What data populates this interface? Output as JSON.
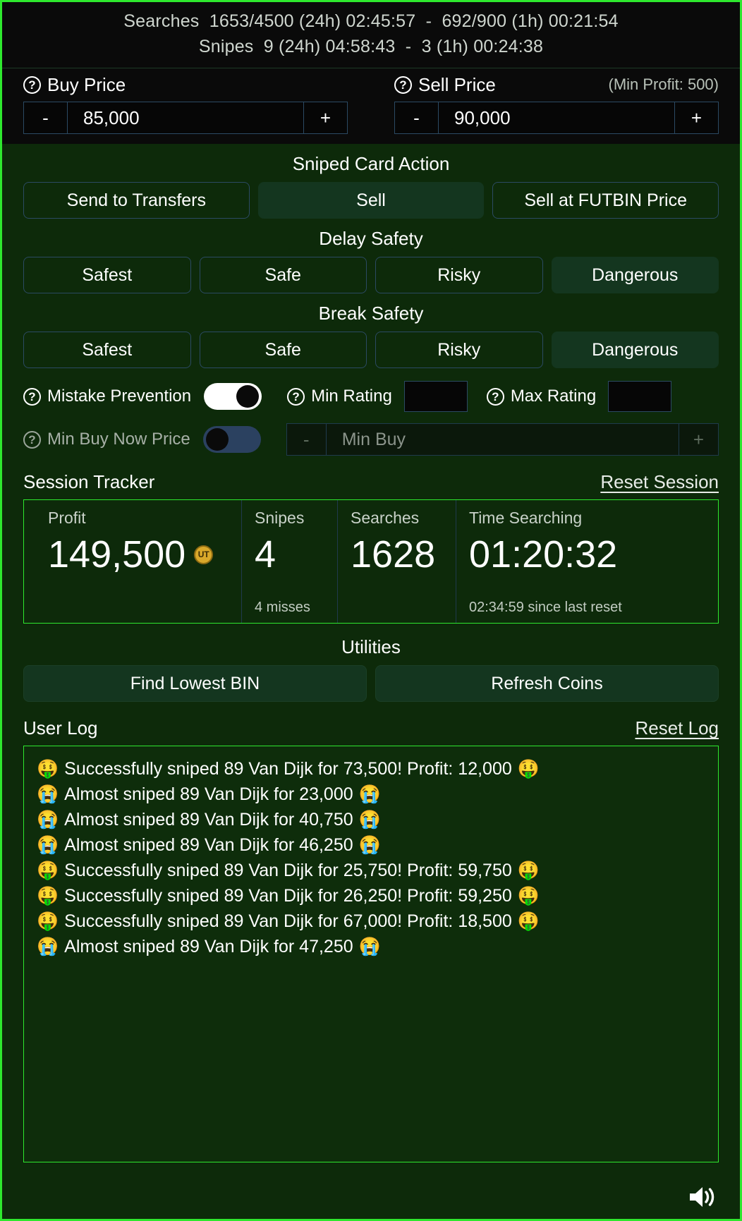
{
  "stats": {
    "line1": "Searches  1653/4500 (24h) 02:45:57  -  692/900 (1h) 00:21:54",
    "line2": "Snipes  9 (24h) 04:58:43  -  3 (1h) 00:24:38"
  },
  "prices": {
    "buy": {
      "label": "Buy Price",
      "value": "85,000",
      "minus": "-",
      "plus": "+"
    },
    "sell": {
      "label": "Sell Price",
      "value": "90,000",
      "minus": "-",
      "plus": "+",
      "min_profit": "(Min Profit: 500)"
    }
  },
  "sniped_card_action": {
    "title": "Sniped Card Action",
    "options": [
      {
        "label": "Send to Transfers",
        "active": false
      },
      {
        "label": "Sell",
        "active": true
      },
      {
        "label": "Sell at FUTBIN Price",
        "active": false
      }
    ]
  },
  "delay_safety": {
    "title": "Delay Safety",
    "options": [
      {
        "label": "Safest",
        "active": false
      },
      {
        "label": "Safe",
        "active": false
      },
      {
        "label": "Risky",
        "active": false
      },
      {
        "label": "Dangerous",
        "active": true
      }
    ]
  },
  "break_safety": {
    "title": "Break Safety",
    "options": [
      {
        "label": "Safest",
        "active": false
      },
      {
        "label": "Safe",
        "active": false
      },
      {
        "label": "Risky",
        "active": false
      },
      {
        "label": "Dangerous",
        "active": true
      }
    ]
  },
  "settings": {
    "mistake_prevention": {
      "label": "Mistake Prevention",
      "on": true
    },
    "min_rating": {
      "label": "Min Rating",
      "value": ""
    },
    "max_rating": {
      "label": "Max Rating",
      "value": ""
    },
    "min_buy_now_price": {
      "label": "Min Buy Now Price",
      "on": false,
      "placeholder": "Min Buy",
      "value": "",
      "minus": "-",
      "plus": "+"
    }
  },
  "session_tracker": {
    "title": "Session Tracker",
    "reset_label": "Reset Session",
    "profit": {
      "caption": "Profit",
      "value": "149,500",
      "coin_icon": "coin-icon",
      "coin_text": "UT"
    },
    "snipes": {
      "caption": "Snipes",
      "value": "4",
      "sub": "4 misses"
    },
    "searches": {
      "caption": "Searches",
      "value": "1628"
    },
    "time_searching": {
      "caption": "Time Searching",
      "value": "01:20:32",
      "sub": "02:34:59 since last reset"
    }
  },
  "utilities": {
    "title": "Utilities",
    "buttons": [
      {
        "label": "Find Lowest BIN"
      },
      {
        "label": "Refresh Coins"
      }
    ]
  },
  "user_log": {
    "title": "User Log",
    "reset_label": "Reset Log",
    "entries": [
      {
        "lead_emoji": "🤑",
        "text": "Successfully sniped 89 Van Dijk for 73,500! Profit: 12,000",
        "trail_emoji": "🤑"
      },
      {
        "lead_emoji": "😭",
        "text": "Almost sniped 89 Van Dijk for 23,000",
        "trail_emoji": "😭"
      },
      {
        "lead_emoji": "😭",
        "text": "Almost sniped 89 Van Dijk for 40,750",
        "trail_emoji": "😭"
      },
      {
        "lead_emoji": "😭",
        "text": "Almost sniped 89 Van Dijk for 46,250",
        "trail_emoji": "😭"
      },
      {
        "lead_emoji": "🤑",
        "text": "Successfully sniped 89 Van Dijk for 25,750! Profit: 59,750",
        "trail_emoji": "🤑"
      },
      {
        "lead_emoji": "🤑",
        "text": "Successfully sniped 89 Van Dijk for 26,250! Profit: 59,250",
        "trail_emoji": "🤑"
      },
      {
        "lead_emoji": "🤑",
        "text": "Successfully sniped 89 Van Dijk for 67,000! Profit: 18,500",
        "trail_emoji": "🤑"
      },
      {
        "lead_emoji": "😭",
        "text": "Almost sniped 89 Van Dijk for 47,250",
        "trail_emoji": "😭"
      }
    ]
  },
  "footer": {
    "sound_icon": "speaker-icon"
  },
  "colors": {
    "accent_border": "#2ee82e",
    "active_button": "#14361f",
    "panel_bg": "#0d2a0a",
    "header_bg": "#0a0a0a",
    "input_border": "#2b4a63"
  },
  "icons": {
    "help": "?"
  }
}
